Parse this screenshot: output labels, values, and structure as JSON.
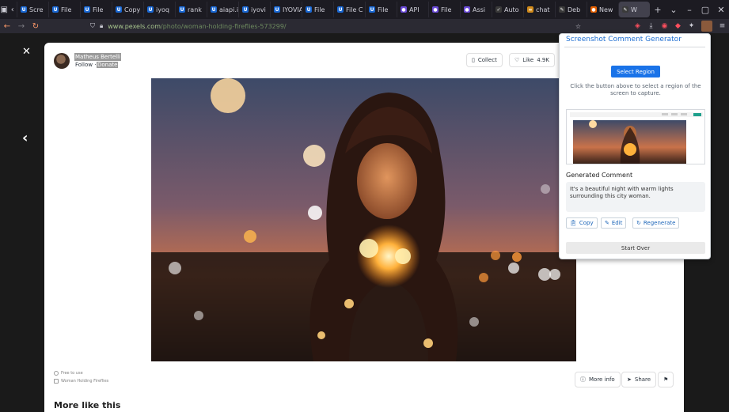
{
  "browser": {
    "tabs": [
      {
        "label": "Scre",
        "fav": "U",
        "color": "#1967d2"
      },
      {
        "label": "File",
        "fav": "U",
        "color": "#1967d2"
      },
      {
        "label": "File",
        "fav": "U",
        "color": "#1967d2"
      },
      {
        "label": "Copy",
        "fav": "U",
        "color": "#1967d2"
      },
      {
        "label": "iyoq",
        "fav": "U",
        "color": "#1967d2"
      },
      {
        "label": "rank",
        "fav": "U",
        "color": "#1967d2"
      },
      {
        "label": "aiapi.iyo",
        "fav": "U",
        "color": "#1967d2"
      },
      {
        "label": "iyovi",
        "fav": "U",
        "color": "#1967d2"
      },
      {
        "label": "IYOVIA",
        "fav": "U",
        "color": "#1967d2"
      },
      {
        "label": "File",
        "fav": "U",
        "color": "#1967d2"
      },
      {
        "label": "File C",
        "fav": "U",
        "color": "#1967d2"
      },
      {
        "label": "File",
        "fav": "U",
        "color": "#1967d2"
      },
      {
        "label": "API",
        "fav": "●",
        "color": "#6b4bd8"
      },
      {
        "label": "File",
        "fav": "●",
        "color": "#6b4bd8"
      },
      {
        "label": "Assi",
        "fav": "●",
        "color": "#6b4bd8"
      },
      {
        "label": "Auto",
        "fav": "✓",
        "color": "#3a3a3a"
      },
      {
        "label": "chat",
        "fav": "∞",
        "color": "#d08a1a"
      },
      {
        "label": "Deb",
        "fav": "✎",
        "color": "#3a3a3a"
      },
      {
        "label": "New",
        "fav": "●",
        "color": "#e66000"
      },
      {
        "label": "W",
        "fav": "✎",
        "color": "#3a3a3a",
        "active": true
      }
    ],
    "url_host": "www.pexels.com",
    "url_path": "/photo/woman-holding-fireflies-573299/"
  },
  "author": {
    "name": "Matheus Bertelli",
    "follow": "Follow",
    "separator": "·",
    "donate": "Donate"
  },
  "actions": {
    "collect": "Collect",
    "like": "Like",
    "like_count": "4.9K",
    "more_info": "More info",
    "share": "Share"
  },
  "meta": {
    "free": "Free to use",
    "title": "Woman Holding Fireflies"
  },
  "more_like": "More like this",
  "extension": {
    "title": "Screenshot Comment Generator",
    "select_region": "Select Region",
    "hint": "Click the button above to select a region of the screen to capture.",
    "generated_label": "Generated Comment",
    "comment": "It's a beautiful night with warm lights surrounding this city woman.",
    "copy": "Copy",
    "edit": "Edit",
    "regenerate": "Regenerate",
    "start_over": "Start Over"
  }
}
